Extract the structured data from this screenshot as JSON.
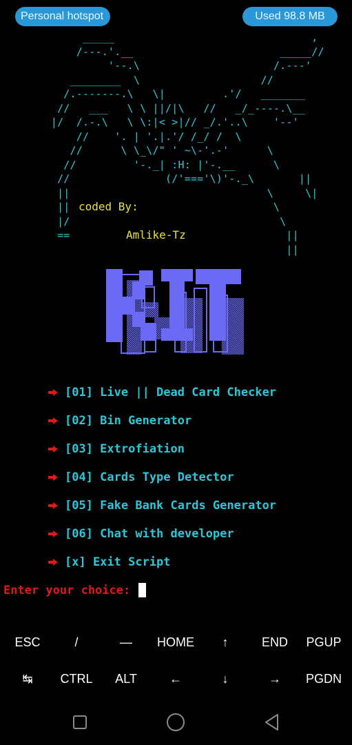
{
  "status_bar": {
    "hotspot_label": "Personal hotspot",
    "data_usage_label": "Used  98.8 MB"
  },
  "ascii_art": {
    "banner": "             _____                               ,\n            /---.'.__                       _____//\n                 '--.\\                     /.---'\n           ________  \\                   //\n          /.-------.\\   \\|         .'/   _______\n         //   ___   \\ \\ ||/|\\   //   _/_----.\\__\n        |/  /.-.\\   \\ \\:|< >|// _/.'..\\    '--'\n            //    '. | '.|.'/ /_/ /  \\\n           //      \\ \\_\\/\" ' ~\\-'.-'      \\\n          //         '-._| :H: |'-.__      \\\n         //               (/'==='\\)'-._\\       ||\n         ||                               \\     \\|\n         ||                                \\\n         |/                                 \\\n         ==                                  ||\n                                             ||",
    "coded_by": "coded By:",
    "author": "Amlike-Tz",
    "logo_text": "KIT"
  },
  "menu": {
    "items": [
      {
        "label": "[01] Live || Dead Card Checker"
      },
      {
        "label": "[02] Bin Generator"
      },
      {
        "label": "[03] Extrofiation"
      },
      {
        "label": "[04] Cards Type Detector"
      },
      {
        "label": "[05] Fake Bank Cards Generator"
      },
      {
        "label": "[06] Chat with developer"
      },
      {
        "label": "[x] Exit Script"
      }
    ],
    "bullet_icon": "right-arrow-icon"
  },
  "prompt": {
    "text": "Enter your choice:"
  },
  "extra_keys": {
    "row1": [
      "ESC",
      "/",
      "—",
      "HOME",
      "↑",
      "END",
      "PGUP"
    ],
    "row2": [
      "↹",
      "CTRL",
      "ALT",
      "←",
      "↓",
      "→",
      "PGDN"
    ]
  },
  "nav_bar": {
    "icons": [
      "recents-square-icon",
      "home-circle-icon",
      "back-triangle-icon"
    ]
  },
  "colors": {
    "background": "#000000",
    "cyan": "#2ec7d8",
    "yellow": "#e8e23a",
    "red": "#e01a1a",
    "logo_blue": "#6a6af5",
    "pill_blue": "#2a98d6"
  }
}
